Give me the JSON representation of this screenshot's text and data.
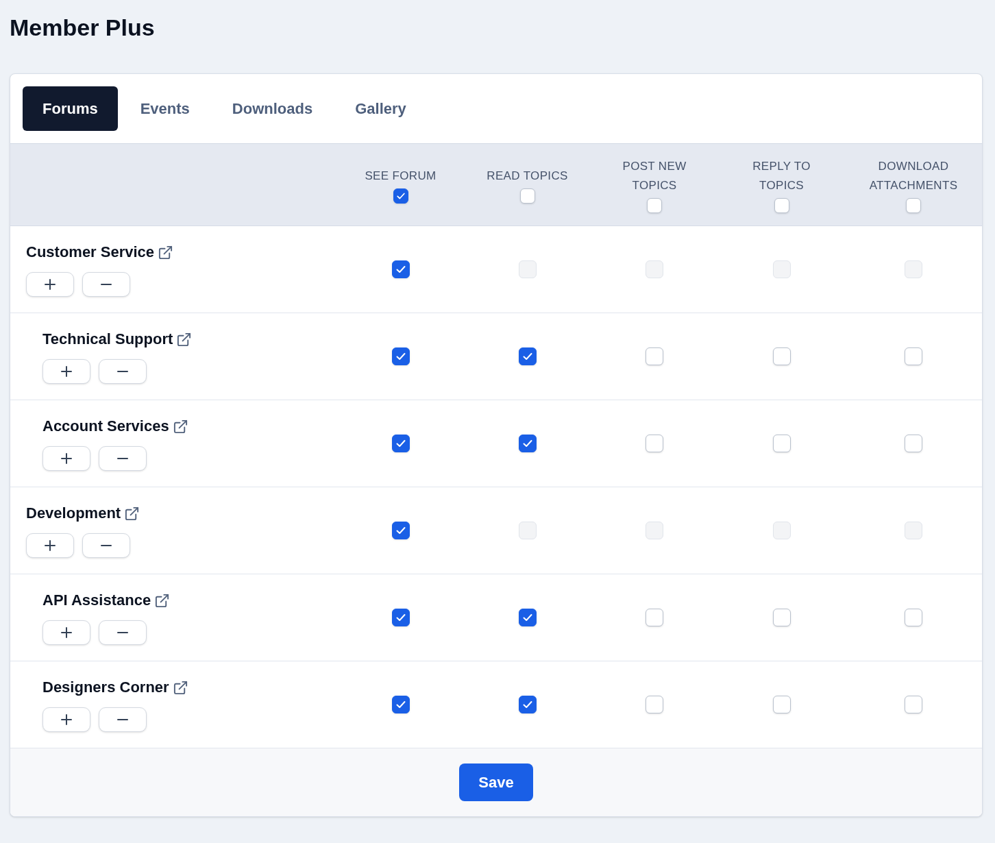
{
  "page": {
    "title": "Member Plus"
  },
  "tabs": [
    {
      "label": "Forums",
      "selected": true
    },
    {
      "label": "Events",
      "selected": false
    },
    {
      "label": "Downloads",
      "selected": false
    },
    {
      "label": "Gallery",
      "selected": false
    }
  ],
  "table": {
    "columns": [
      {
        "label": "SEE FORUM",
        "checked": true
      },
      {
        "label": "READ TOPICS",
        "checked": false
      },
      {
        "label": "POST NEW TOPICS",
        "checked": false
      },
      {
        "label": "REPLY TO TOPICS",
        "checked": false
      },
      {
        "label": "DOWNLOAD ATTACHMENTS",
        "checked": false
      }
    ],
    "rows": [
      {
        "name": "Customer Service",
        "permissions": [
          {
            "checked": true,
            "disabled": false
          },
          {
            "checked": false,
            "disabled": true
          },
          {
            "checked": false,
            "disabled": true
          },
          {
            "checked": false,
            "disabled": true
          },
          {
            "checked": false,
            "disabled": true
          }
        ],
        "children": [
          {
            "name": "Technical Support",
            "permissions": [
              {
                "checked": true,
                "disabled": false
              },
              {
                "checked": true,
                "disabled": false
              },
              {
                "checked": false,
                "disabled": false
              },
              {
                "checked": false,
                "disabled": false
              },
              {
                "checked": false,
                "disabled": false
              }
            ]
          },
          {
            "name": "Account Services",
            "permissions": [
              {
                "checked": true,
                "disabled": false
              },
              {
                "checked": true,
                "disabled": false
              },
              {
                "checked": false,
                "disabled": false
              },
              {
                "checked": false,
                "disabled": false
              },
              {
                "checked": false,
                "disabled": false
              }
            ]
          }
        ]
      },
      {
        "name": "Development",
        "permissions": [
          {
            "checked": true,
            "disabled": false
          },
          {
            "checked": false,
            "disabled": true
          },
          {
            "checked": false,
            "disabled": true
          },
          {
            "checked": false,
            "disabled": true
          },
          {
            "checked": false,
            "disabled": true
          }
        ],
        "children": [
          {
            "name": "API Assistance",
            "permissions": [
              {
                "checked": true,
                "disabled": false
              },
              {
                "checked": true,
                "disabled": false
              },
              {
                "checked": false,
                "disabled": false
              },
              {
                "checked": false,
                "disabled": false
              },
              {
                "checked": false,
                "disabled": false
              }
            ]
          },
          {
            "name": "Designers Corner",
            "permissions": [
              {
                "checked": true,
                "disabled": false
              },
              {
                "checked": true,
                "disabled": false
              },
              {
                "checked": false,
                "disabled": false
              },
              {
                "checked": false,
                "disabled": false
              },
              {
                "checked": false,
                "disabled": false
              }
            ]
          }
        ]
      }
    ]
  },
  "footer": {
    "save_button": "Save"
  }
}
